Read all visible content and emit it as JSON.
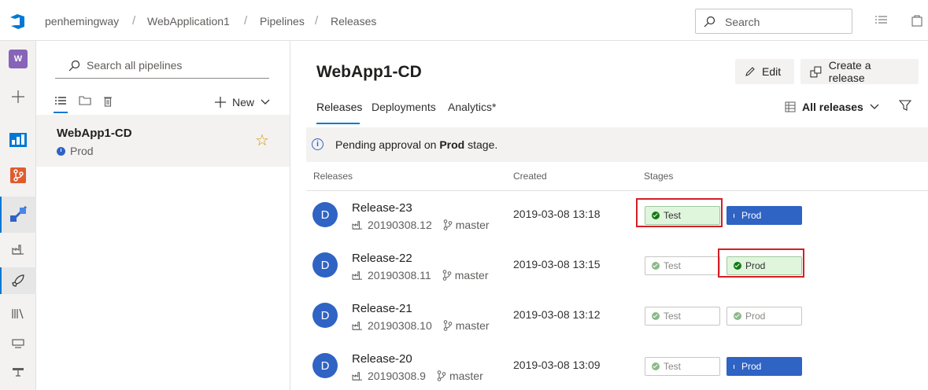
{
  "breadcrumb": [
    "penhemingway",
    "WebApplication1",
    "Pipelines",
    "Releases"
  ],
  "search": {
    "placeholder": "Search"
  },
  "rail": {
    "project_initial": "W"
  },
  "pane": {
    "search_placeholder": "Search all pipelines",
    "new_label": "New",
    "pipeline": {
      "name": "WebApp1-CD",
      "stage": "Prod"
    }
  },
  "main": {
    "title": "WebApp1-CD",
    "edit_label": "Edit",
    "create_label": "Create a release",
    "tabs": [
      "Releases",
      "Deployments",
      "Analytics*"
    ],
    "filter_label": "All releases",
    "banner": {
      "prefix": "Pending approval on ",
      "stage": "Prod",
      "suffix": " stage."
    },
    "columns": [
      "Releases",
      "Created",
      "Stages"
    ],
    "releases": [
      {
        "avatar": "D",
        "name": "Release-23",
        "build": "20190308.12",
        "branch": "master",
        "created": "2019-03-08 13:18",
        "stages": [
          {
            "label": "Test",
            "status": "succeeded-highlight"
          },
          {
            "label": "Prod",
            "status": "pending"
          }
        ]
      },
      {
        "avatar": "D",
        "name": "Release-22",
        "build": "20190308.11",
        "branch": "master",
        "created": "2019-03-08 13:15",
        "stages": [
          {
            "label": "Test",
            "status": "succeeded"
          },
          {
            "label": "Prod",
            "status": "succeeded-highlight"
          }
        ]
      },
      {
        "avatar": "D",
        "name": "Release-21",
        "build": "20190308.10",
        "branch": "master",
        "created": "2019-03-08 13:12",
        "stages": [
          {
            "label": "Test",
            "status": "succeeded"
          },
          {
            "label": "Prod",
            "status": "succeeded"
          }
        ]
      },
      {
        "avatar": "D",
        "name": "Release-20",
        "build": "20190308.9",
        "branch": "master",
        "created": "2019-03-08 13:09",
        "stages": [
          {
            "label": "Test",
            "status": "succeeded"
          },
          {
            "label": "Prod",
            "status": "pending"
          }
        ]
      }
    ]
  },
  "colors": {
    "accent": "#0078d4",
    "pending": "#2f63c4",
    "success": "#107c10",
    "highlight": "#d41f26"
  }
}
